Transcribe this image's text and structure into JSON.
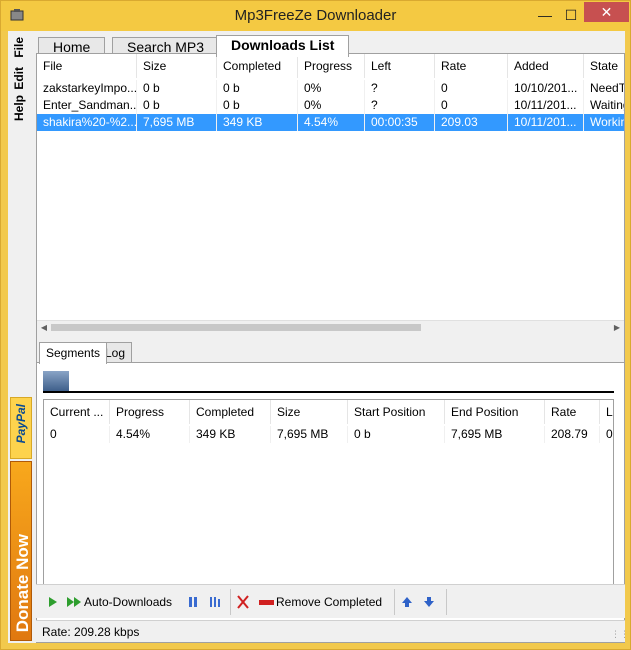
{
  "window": {
    "title": "Mp3FreeZe Downloader"
  },
  "sidebar": {
    "menus": [
      "File",
      "Edit",
      "Help"
    ],
    "paypal": "PayPal",
    "donate": "Donate Now"
  },
  "tabs": [
    {
      "label": "Home"
    },
    {
      "label": "Search MP3"
    },
    {
      "label": "Downloads List"
    }
  ],
  "downloads": {
    "columns": [
      "File",
      "Size",
      "Completed",
      "Progress",
      "Left",
      "Rate",
      "Added",
      "State"
    ],
    "rows": [
      [
        "zakstarkeyImpo...",
        "0 b",
        "0 b",
        "0%",
        "?",
        "0",
        "10/10/201...",
        "NeedTo"
      ],
      [
        "Enter_Sandman...",
        "0 b",
        "0 b",
        "0%",
        "?",
        "0",
        "10/11/201...",
        "Waiting"
      ],
      [
        "shakira%20-%2...",
        "7,695 MB",
        "349 KB",
        "4.54%",
        "00:00:35",
        "209.03",
        "10/11/201...",
        "Workin"
      ]
    ]
  },
  "lower_tabs": [
    {
      "label": "Segments"
    },
    {
      "label": "Log"
    }
  ],
  "segments": {
    "columns": [
      "Current ...",
      "Progress",
      "Completed",
      "Size",
      "Start Position",
      "End Position",
      "Rate",
      "L"
    ],
    "rows": [
      [
        "0",
        "4.54%",
        "349 KB",
        "7,695 MB",
        "0 b",
        "7,695 MB",
        "208.79",
        "0"
      ]
    ]
  },
  "toolbar": {
    "auto_downloads": "Auto-Downloads",
    "remove_completed": "Remove Completed"
  },
  "status": {
    "text": "Rate:  209.28 kbps"
  },
  "colors": {
    "accent": "#f4c942",
    "selection": "#3399ff",
    "close": "#c75050"
  }
}
